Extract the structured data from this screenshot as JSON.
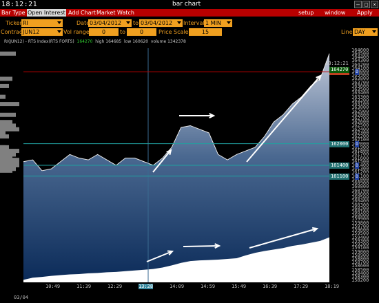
{
  "titlebar": {
    "clock": "18:12:21",
    "title": "bar chart"
  },
  "menubar": {
    "items": [
      "Bar Type",
      "Open Interest",
      "Add Chart",
      "Market Watch"
    ],
    "right": [
      "setup",
      "window",
      "Apply"
    ]
  },
  "controls": {
    "ticker_label": "Ticker",
    "ticker_value": "RI",
    "date_label": "Date",
    "date_from": "03/04/2012",
    "to_label": "to",
    "date_to": "03/04/2012",
    "interval_label": "Interval",
    "interval_value": "1 MIN",
    "contract_label": "Contract",
    "contract_value": "JUN12",
    "volrange_label": "Vol range",
    "volrange_from": "0",
    "volrange_to_label": "to",
    "volrange_to": "0",
    "pricescale_label": "Price Scale",
    "pricescale_value": "15",
    "line_label": "Line",
    "line_value": "DAY"
  },
  "chart_data": {
    "type": "area",
    "info": {
      "symbol": "RI(JUN12) - RTS Index(RTS FORTS)",
      "last": "164270",
      "high_label": "high",
      "high": "164685",
      "low_label": "low",
      "low": "160620",
      "volume_label": "volume",
      "volume": "1342378"
    },
    "y_ticks": [
      "164600",
      "164500",
      "164400",
      "164300",
      "164200",
      "164100",
      "164000",
      "163900",
      "163800",
      "163700",
      "163600",
      "163500",
      "163400",
      "163300",
      "163200",
      "163100",
      "163000",
      "162900",
      "162800",
      "162700",
      "162600",
      "162500",
      "162400",
      "162300",
      "162200",
      "162100",
      "162000",
      "161900",
      "161800",
      "161700",
      "161600",
      "161500",
      "161400",
      "161300",
      "161200",
      "161100",
      "161000",
      "160900",
      "160800",
      "160700",
      "160600",
      "160500",
      "160400",
      "160300",
      "160200",
      "160100",
      "160000",
      "159900",
      "159800",
      "159700",
      "159600",
      "159500",
      "159400",
      "159300",
      "159200",
      "159100",
      "159000",
      "158900",
      "158800",
      "158700",
      "158600",
      "158500",
      "158400",
      "158300",
      "158200"
    ],
    "x_ticks": [
      "10:49",
      "11:39",
      "12:29",
      "13:28",
      "14:09",
      "14:59",
      "15:49",
      "16:39",
      "17:29",
      "18:19"
    ],
    "x_highlight": "13:28",
    "date_label": "03/04",
    "ylim": [
      158150,
      164650
    ],
    "time_points": [
      "10:00",
      "10:15",
      "10:30",
      "10:45",
      "11:00",
      "11:15",
      "11:30",
      "11:45",
      "12:00",
      "12:15",
      "12:30",
      "12:45",
      "13:00",
      "13:15",
      "13:30",
      "13:45",
      "14:00",
      "14:15",
      "14:30",
      "14:45",
      "15:00",
      "15:15",
      "15:30",
      "15:45",
      "16:00",
      "16:15",
      "16:30",
      "16:45",
      "17:00",
      "17:15",
      "17:30",
      "17:45",
      "18:00",
      "18:15"
    ],
    "price": [
      161500,
      161550,
      161250,
      161300,
      161500,
      161700,
      161600,
      161550,
      161700,
      161550,
      161400,
      161600,
      161600,
      161500,
      161400,
      161600,
      161900,
      162450,
      162500,
      162400,
      162300,
      161700,
      161550,
      161700,
      161800,
      161900,
      162200,
      162600,
      162800,
      163100,
      163300,
      163600,
      163800,
      164500
    ],
    "volume": [
      158220,
      158280,
      158300,
      158330,
      158350,
      158370,
      158380,
      158400,
      158410,
      158430,
      158440,
      158460,
      158480,
      158500,
      158520,
      158560,
      158620,
      158690,
      158740,
      158760,
      158770,
      158780,
      158800,
      158820,
      158900,
      158970,
      159020,
      159060,
      159100,
      159160,
      159200,
      159250,
      159300,
      159400
    ],
    "levels": [
      {
        "value": "163995",
        "color": "#c04020",
        "line": "#c00000"
      },
      {
        "value": "162000",
        "color": "#207070",
        "line": "#20a0a0"
      },
      {
        "value": "161400",
        "color": "#207070",
        "line": "#20a0a0"
      },
      {
        "value": "161100",
        "color": "#207070",
        "line": "#20a0a0"
      }
    ],
    "level_flag": "D",
    "last_tag": "164270",
    "last_time": "18:12:21"
  }
}
